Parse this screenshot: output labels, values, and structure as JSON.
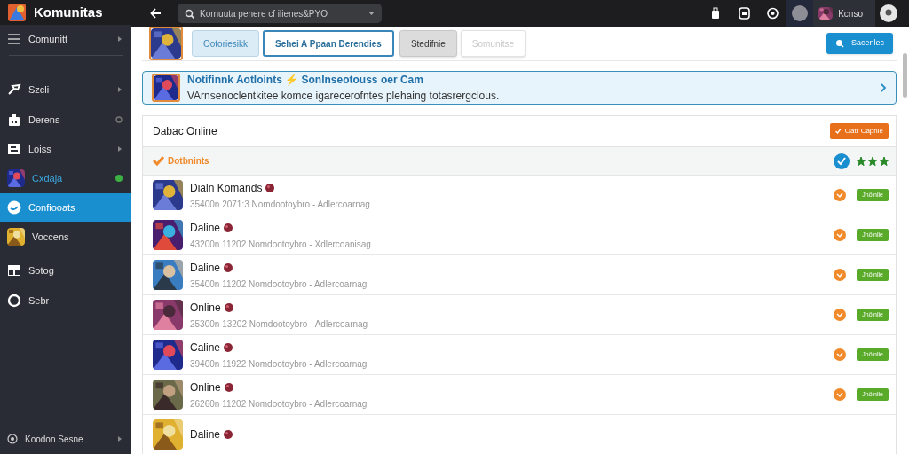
{
  "app": {
    "title": "Komunitas"
  },
  "sidebar": {
    "items": [
      {
        "label": "Comunitt",
        "selected": false,
        "kind": "chevron"
      },
      {
        "label": "Szcli",
        "selected": false,
        "kind": "chevron"
      },
      {
        "label": "Derens",
        "selected": false,
        "kind": "ring"
      },
      {
        "label": "Loiss",
        "selected": false,
        "kind": "chevron"
      },
      {
        "label": "Cxdaja",
        "selected": false,
        "kind": "dot",
        "highlight": true
      },
      {
        "label": "Confiooats",
        "selected": true
      },
      {
        "label": "Voccens",
        "selected": false
      },
      {
        "label": "Sotog",
        "selected": false
      },
      {
        "label": "Sebr",
        "selected": false
      }
    ],
    "footer": {
      "label": "Koodon Sesne"
    }
  },
  "topbar": {
    "search": {
      "value": "Kornuuta penere cf ilienes&PYO"
    },
    "user": {
      "name": "Kcnso"
    }
  },
  "tabs": [
    {
      "label": "Ootoriesikk",
      "selected": false,
      "kind": "tinted"
    },
    {
      "label": "Sehei A Ppaan Derendies",
      "selected": true,
      "kind": "outlined"
    },
    {
      "label": "Stedifnie",
      "selected": false,
      "kind": "gray"
    },
    {
      "label": "Somunitse",
      "selected": false,
      "kind": "disabled"
    }
  ],
  "search_button": {
    "label": "Sacenlec"
  },
  "banner": {
    "title": "Notifinnk Aotloints ⚡ Sonlnseotouss oer Cam",
    "text": "VArnsenoclentkitee komce igarecerofntes plehaing totasrergclous."
  },
  "panel": {
    "title": "Dabac Online",
    "action": "Oatr Capnie",
    "section": {
      "label": "Dotbnints",
      "stars": 3
    },
    "rows": [
      {
        "name": "Dialn Komands",
        "meta": "35400n 2071:3 Nomdootoybro - Adlercoarnag",
        "status": "Jnölnlie"
      },
      {
        "name": "Daline",
        "meta": "43200n 11202 Nomdootoybro - Xdlercoanisag",
        "status": "Jnölnlie"
      },
      {
        "name": "Daline",
        "meta": "35400n 11202 Nomdootoybro - Adlercoarnag",
        "status": "Jnölnlie"
      },
      {
        "name": "Online",
        "meta": "25300n 13202 Nomdootoybro - Adlercoarnag",
        "status": "Jnölnlie"
      },
      {
        "name": "Caline",
        "meta": "39400n 11922 Nomdootoybro - Adlercoarnag",
        "status": "Jnölnlie"
      },
      {
        "name": "Online",
        "meta": "26260n 11202 Nomdootoybro - Adlercoarnag",
        "status": "Jnölnlie"
      },
      {
        "name": "Daline"
      }
    ]
  }
}
